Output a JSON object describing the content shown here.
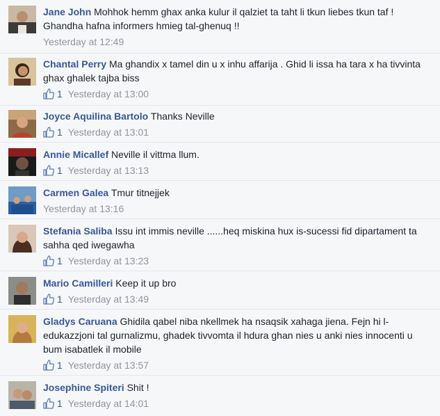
{
  "comments": [
    {
      "author": "Jane John",
      "text": "Mohhok hemm ghax anka kulur il qalziet ta taht li tkun liebes tkun taf ! Ghandha hafna informers hmieg tal-ghenuq !!",
      "likes": "",
      "time": "Yesterday at 12:49",
      "avatar": "avatar-jane-john"
    },
    {
      "author": "Chantal Perry",
      "text": "Ma ghandix x tamel din u x inhu affarija . Ghid li issa ha tara x ha tivvinta ghax ghalek tajba biss",
      "likes": "1",
      "time": "Yesterday at 13:00",
      "avatar": "avatar-chantal-perry"
    },
    {
      "author": "Joyce Aquilina Bartolo",
      "text": "Thanks Neville",
      "likes": "1",
      "time": "Yesterday at 13:01",
      "avatar": "avatar-joyce-aquilina-bartolo"
    },
    {
      "author": "Annie Micallef",
      "text": "Neville il vittma llum.",
      "likes": "1",
      "time": "Yesterday at 13:13",
      "avatar": "avatar-annie-micallef"
    },
    {
      "author": "Carmen Galea",
      "text": "Tmur titnejjek",
      "likes": "",
      "time": "Yesterday at 13:16",
      "avatar": "avatar-carmen-galea"
    },
    {
      "author": "Stefania Saliba",
      "text": "Issu int immis neville ......heq miskina hux is-sucessi fid dipartament ta sahha qed iwegawha",
      "likes": "1",
      "time": "Yesterday at 13:23",
      "avatar": "avatar-stefania-saliba"
    },
    {
      "author": "Mario Camilleri",
      "text": "Keep it up bro",
      "likes": "1",
      "time": "Yesterday at 13:49",
      "avatar": "avatar-mario-camilleri"
    },
    {
      "author": "Gladys Caruana",
      "text": "Ghidila qabel niba nkellmek ha nsaqsik xahaga jiena. Fejn hi l-edukazzjoni tal gurnalizmu, ghadek tivvomta il hdura ghan nies u anki nies innocenti u bum isabatlek il mobile",
      "likes": "1",
      "time": "Yesterday at 13:57",
      "avatar": "avatar-gladys-caruana"
    },
    {
      "author": "Josephine Spiteri",
      "text": "Shit !",
      "likes": "1",
      "time": "Yesterday at 14:01",
      "avatar": "avatar-josephine-spiteri"
    }
  ],
  "colors": {
    "author": "#365899",
    "meta": "#90949c",
    "text": "#1d2129",
    "background": "#f6f7f9"
  }
}
